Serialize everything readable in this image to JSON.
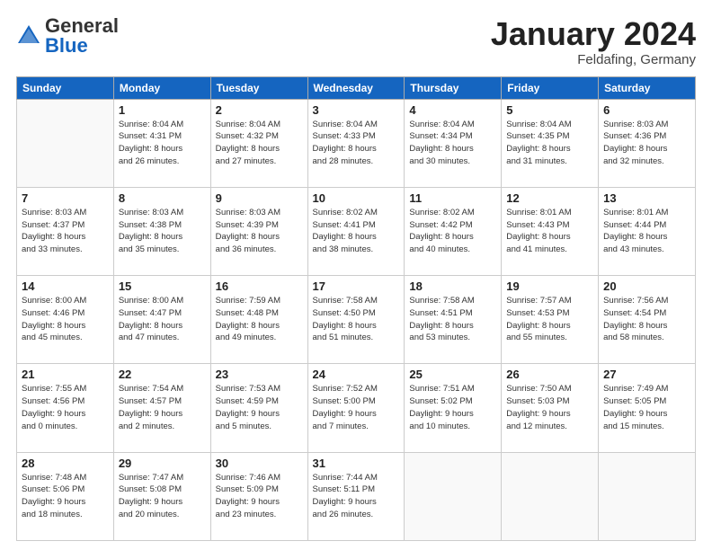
{
  "logo": {
    "general": "General",
    "blue": "Blue"
  },
  "header": {
    "month": "January 2024",
    "location": "Feldafing, Germany"
  },
  "weekdays": [
    "Sunday",
    "Monday",
    "Tuesday",
    "Wednesday",
    "Thursday",
    "Friday",
    "Saturday"
  ],
  "weeks": [
    [
      {
        "day": "",
        "info": ""
      },
      {
        "day": "1",
        "info": "Sunrise: 8:04 AM\nSunset: 4:31 PM\nDaylight: 8 hours\nand 26 minutes."
      },
      {
        "day": "2",
        "info": "Sunrise: 8:04 AM\nSunset: 4:32 PM\nDaylight: 8 hours\nand 27 minutes."
      },
      {
        "day": "3",
        "info": "Sunrise: 8:04 AM\nSunset: 4:33 PM\nDaylight: 8 hours\nand 28 minutes."
      },
      {
        "day": "4",
        "info": "Sunrise: 8:04 AM\nSunset: 4:34 PM\nDaylight: 8 hours\nand 30 minutes."
      },
      {
        "day": "5",
        "info": "Sunrise: 8:04 AM\nSunset: 4:35 PM\nDaylight: 8 hours\nand 31 minutes."
      },
      {
        "day": "6",
        "info": "Sunrise: 8:03 AM\nSunset: 4:36 PM\nDaylight: 8 hours\nand 32 minutes."
      }
    ],
    [
      {
        "day": "7",
        "info": "Sunrise: 8:03 AM\nSunset: 4:37 PM\nDaylight: 8 hours\nand 33 minutes."
      },
      {
        "day": "8",
        "info": "Sunrise: 8:03 AM\nSunset: 4:38 PM\nDaylight: 8 hours\nand 35 minutes."
      },
      {
        "day": "9",
        "info": "Sunrise: 8:03 AM\nSunset: 4:39 PM\nDaylight: 8 hours\nand 36 minutes."
      },
      {
        "day": "10",
        "info": "Sunrise: 8:02 AM\nSunset: 4:41 PM\nDaylight: 8 hours\nand 38 minutes."
      },
      {
        "day": "11",
        "info": "Sunrise: 8:02 AM\nSunset: 4:42 PM\nDaylight: 8 hours\nand 40 minutes."
      },
      {
        "day": "12",
        "info": "Sunrise: 8:01 AM\nSunset: 4:43 PM\nDaylight: 8 hours\nand 41 minutes."
      },
      {
        "day": "13",
        "info": "Sunrise: 8:01 AM\nSunset: 4:44 PM\nDaylight: 8 hours\nand 43 minutes."
      }
    ],
    [
      {
        "day": "14",
        "info": "Sunrise: 8:00 AM\nSunset: 4:46 PM\nDaylight: 8 hours\nand 45 minutes."
      },
      {
        "day": "15",
        "info": "Sunrise: 8:00 AM\nSunset: 4:47 PM\nDaylight: 8 hours\nand 47 minutes."
      },
      {
        "day": "16",
        "info": "Sunrise: 7:59 AM\nSunset: 4:48 PM\nDaylight: 8 hours\nand 49 minutes."
      },
      {
        "day": "17",
        "info": "Sunrise: 7:58 AM\nSunset: 4:50 PM\nDaylight: 8 hours\nand 51 minutes."
      },
      {
        "day": "18",
        "info": "Sunrise: 7:58 AM\nSunset: 4:51 PM\nDaylight: 8 hours\nand 53 minutes."
      },
      {
        "day": "19",
        "info": "Sunrise: 7:57 AM\nSunset: 4:53 PM\nDaylight: 8 hours\nand 55 minutes."
      },
      {
        "day": "20",
        "info": "Sunrise: 7:56 AM\nSunset: 4:54 PM\nDaylight: 8 hours\nand 58 minutes."
      }
    ],
    [
      {
        "day": "21",
        "info": "Sunrise: 7:55 AM\nSunset: 4:56 PM\nDaylight: 9 hours\nand 0 minutes."
      },
      {
        "day": "22",
        "info": "Sunrise: 7:54 AM\nSunset: 4:57 PM\nDaylight: 9 hours\nand 2 minutes."
      },
      {
        "day": "23",
        "info": "Sunrise: 7:53 AM\nSunset: 4:59 PM\nDaylight: 9 hours\nand 5 minutes."
      },
      {
        "day": "24",
        "info": "Sunrise: 7:52 AM\nSunset: 5:00 PM\nDaylight: 9 hours\nand 7 minutes."
      },
      {
        "day": "25",
        "info": "Sunrise: 7:51 AM\nSunset: 5:02 PM\nDaylight: 9 hours\nand 10 minutes."
      },
      {
        "day": "26",
        "info": "Sunrise: 7:50 AM\nSunset: 5:03 PM\nDaylight: 9 hours\nand 12 minutes."
      },
      {
        "day": "27",
        "info": "Sunrise: 7:49 AM\nSunset: 5:05 PM\nDaylight: 9 hours\nand 15 minutes."
      }
    ],
    [
      {
        "day": "28",
        "info": "Sunrise: 7:48 AM\nSunset: 5:06 PM\nDaylight: 9 hours\nand 18 minutes."
      },
      {
        "day": "29",
        "info": "Sunrise: 7:47 AM\nSunset: 5:08 PM\nDaylight: 9 hours\nand 20 minutes."
      },
      {
        "day": "30",
        "info": "Sunrise: 7:46 AM\nSunset: 5:09 PM\nDaylight: 9 hours\nand 23 minutes."
      },
      {
        "day": "31",
        "info": "Sunrise: 7:44 AM\nSunset: 5:11 PM\nDaylight: 9 hours\nand 26 minutes."
      },
      {
        "day": "",
        "info": ""
      },
      {
        "day": "",
        "info": ""
      },
      {
        "day": "",
        "info": ""
      }
    ]
  ]
}
